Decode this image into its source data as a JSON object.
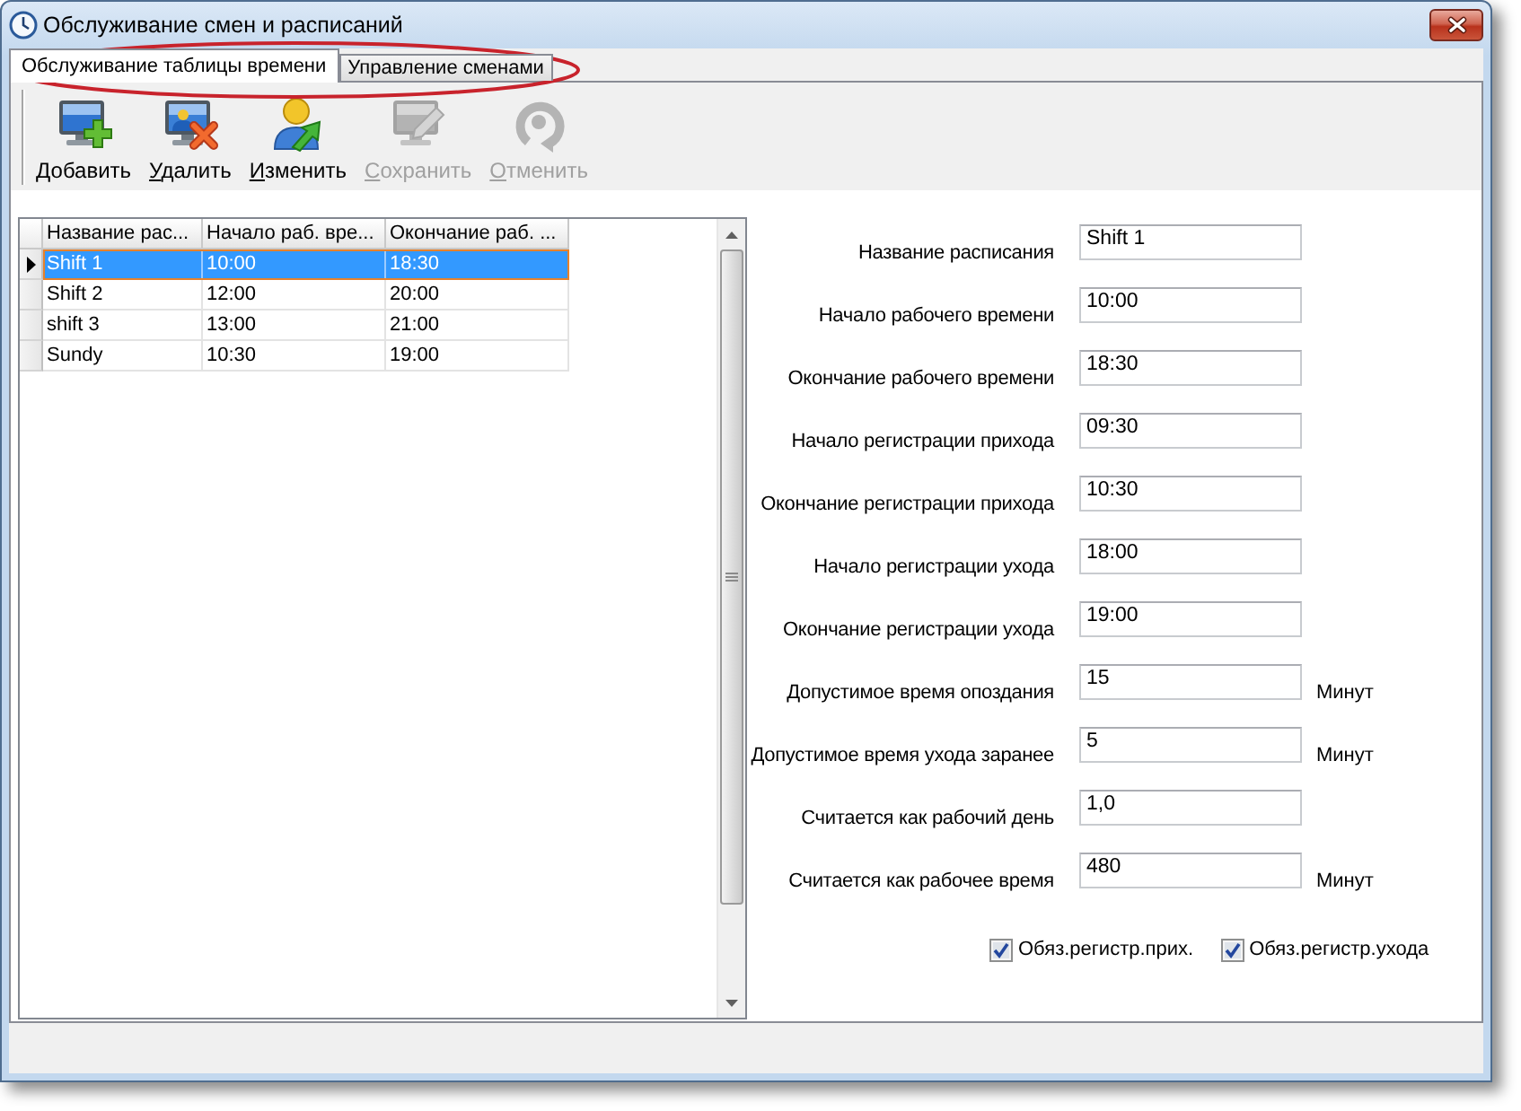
{
  "window": {
    "title": "Обслуживание смен и расписаний"
  },
  "tabs": [
    {
      "label": "Обслуживание таблицы времени",
      "selected": true
    },
    {
      "label": "Управление сменами",
      "selected": false
    }
  ],
  "toolbar": [
    {
      "kind": "add",
      "label": "Добавить",
      "disabled": false
    },
    {
      "kind": "delete",
      "label": "Удалить",
      "disabled": false
    },
    {
      "kind": "edit",
      "label": "Изменить",
      "disabled": false
    },
    {
      "kind": "save",
      "label": "Сохранить",
      "disabled": true
    },
    {
      "kind": "cancel",
      "label": "Отменить",
      "disabled": true
    }
  ],
  "table": {
    "columns": [
      "Название рас...",
      "Начало раб. вре...",
      "Окончание раб. ..."
    ],
    "rows": [
      {
        "cells": [
          "Shift 1",
          "10:00",
          "18:30"
        ],
        "selected": true
      },
      {
        "cells": [
          "Shift 2",
          "12:00",
          "20:00"
        ],
        "selected": false
      },
      {
        "cells": [
          "shift 3",
          "13:00",
          "21:00"
        ],
        "selected": false
      },
      {
        "cells": [
          "Sundy",
          "10:30",
          "19:00"
        ],
        "selected": false
      }
    ]
  },
  "form": {
    "fields": [
      {
        "label": "Название расписания",
        "value": "Shift 1"
      },
      {
        "label": "Начало рабочего времени",
        "value": "10:00"
      },
      {
        "label": "Окончание рабочего времени",
        "value": "18:30"
      },
      {
        "label": "Начало регистрации прихода",
        "value": "09:30"
      },
      {
        "label": "Окончание регистрации прихода",
        "value": "10:30"
      },
      {
        "label": "Начало регистрации ухода",
        "value": "18:00"
      },
      {
        "label": "Окончание регистрации ухода",
        "value": "19:00"
      },
      {
        "label": "Допустимое время опоздания",
        "value": "15",
        "unit": "Минут"
      },
      {
        "label": "Допустимое время ухода заранее",
        "value": "5",
        "unit": "Минут"
      },
      {
        "label": "Считается как рабочий день",
        "value": "1,0"
      },
      {
        "label": "Считается как рабочее время",
        "value": "480",
        "unit": "Минут"
      }
    ],
    "checkboxes": [
      {
        "label": "Обяз.регистр.прих.",
        "checked": true
      },
      {
        "label": "Обяз.регистр.ухода",
        "checked": true
      }
    ]
  }
}
